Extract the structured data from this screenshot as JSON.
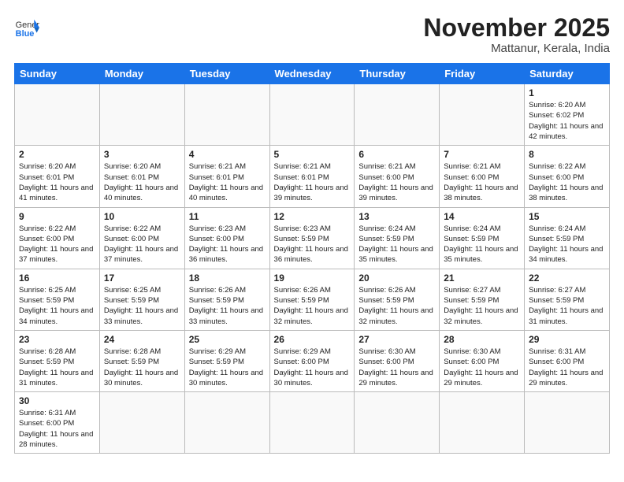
{
  "header": {
    "logo_general": "General",
    "logo_blue": "Blue",
    "month_title": "November 2025",
    "location": "Mattanur, Kerala, India"
  },
  "weekdays": [
    "Sunday",
    "Monday",
    "Tuesday",
    "Wednesday",
    "Thursday",
    "Friday",
    "Saturday"
  ],
  "weeks": [
    [
      {
        "day": "",
        "sunrise": "",
        "sunset": "",
        "daylight": ""
      },
      {
        "day": "",
        "sunrise": "",
        "sunset": "",
        "daylight": ""
      },
      {
        "day": "",
        "sunrise": "",
        "sunset": "",
        "daylight": ""
      },
      {
        "day": "",
        "sunrise": "",
        "sunset": "",
        "daylight": ""
      },
      {
        "day": "",
        "sunrise": "",
        "sunset": "",
        "daylight": ""
      },
      {
        "day": "",
        "sunrise": "",
        "sunset": "",
        "daylight": ""
      },
      {
        "day": "1",
        "sunrise": "Sunrise: 6:20 AM",
        "sunset": "Sunset: 6:02 PM",
        "daylight": "Daylight: 11 hours and 42 minutes."
      }
    ],
    [
      {
        "day": "2",
        "sunrise": "Sunrise: 6:20 AM",
        "sunset": "Sunset: 6:01 PM",
        "daylight": "Daylight: 11 hours and 41 minutes."
      },
      {
        "day": "3",
        "sunrise": "Sunrise: 6:20 AM",
        "sunset": "Sunset: 6:01 PM",
        "daylight": "Daylight: 11 hours and 40 minutes."
      },
      {
        "day": "4",
        "sunrise": "Sunrise: 6:21 AM",
        "sunset": "Sunset: 6:01 PM",
        "daylight": "Daylight: 11 hours and 40 minutes."
      },
      {
        "day": "5",
        "sunrise": "Sunrise: 6:21 AM",
        "sunset": "Sunset: 6:01 PM",
        "daylight": "Daylight: 11 hours and 39 minutes."
      },
      {
        "day": "6",
        "sunrise": "Sunrise: 6:21 AM",
        "sunset": "Sunset: 6:00 PM",
        "daylight": "Daylight: 11 hours and 39 minutes."
      },
      {
        "day": "7",
        "sunrise": "Sunrise: 6:21 AM",
        "sunset": "Sunset: 6:00 PM",
        "daylight": "Daylight: 11 hours and 38 minutes."
      },
      {
        "day": "8",
        "sunrise": "Sunrise: 6:22 AM",
        "sunset": "Sunset: 6:00 PM",
        "daylight": "Daylight: 11 hours and 38 minutes."
      }
    ],
    [
      {
        "day": "9",
        "sunrise": "Sunrise: 6:22 AM",
        "sunset": "Sunset: 6:00 PM",
        "daylight": "Daylight: 11 hours and 37 minutes."
      },
      {
        "day": "10",
        "sunrise": "Sunrise: 6:22 AM",
        "sunset": "Sunset: 6:00 PM",
        "daylight": "Daylight: 11 hours and 37 minutes."
      },
      {
        "day": "11",
        "sunrise": "Sunrise: 6:23 AM",
        "sunset": "Sunset: 6:00 PM",
        "daylight": "Daylight: 11 hours and 36 minutes."
      },
      {
        "day": "12",
        "sunrise": "Sunrise: 6:23 AM",
        "sunset": "Sunset: 5:59 PM",
        "daylight": "Daylight: 11 hours and 36 minutes."
      },
      {
        "day": "13",
        "sunrise": "Sunrise: 6:24 AM",
        "sunset": "Sunset: 5:59 PM",
        "daylight": "Daylight: 11 hours and 35 minutes."
      },
      {
        "day": "14",
        "sunrise": "Sunrise: 6:24 AM",
        "sunset": "Sunset: 5:59 PM",
        "daylight": "Daylight: 11 hours and 35 minutes."
      },
      {
        "day": "15",
        "sunrise": "Sunrise: 6:24 AM",
        "sunset": "Sunset: 5:59 PM",
        "daylight": "Daylight: 11 hours and 34 minutes."
      }
    ],
    [
      {
        "day": "16",
        "sunrise": "Sunrise: 6:25 AM",
        "sunset": "Sunset: 5:59 PM",
        "daylight": "Daylight: 11 hours and 34 minutes."
      },
      {
        "day": "17",
        "sunrise": "Sunrise: 6:25 AM",
        "sunset": "Sunset: 5:59 PM",
        "daylight": "Daylight: 11 hours and 33 minutes."
      },
      {
        "day": "18",
        "sunrise": "Sunrise: 6:26 AM",
        "sunset": "Sunset: 5:59 PM",
        "daylight": "Daylight: 11 hours and 33 minutes."
      },
      {
        "day": "19",
        "sunrise": "Sunrise: 6:26 AM",
        "sunset": "Sunset: 5:59 PM",
        "daylight": "Daylight: 11 hours and 32 minutes."
      },
      {
        "day": "20",
        "sunrise": "Sunrise: 6:26 AM",
        "sunset": "Sunset: 5:59 PM",
        "daylight": "Daylight: 11 hours and 32 minutes."
      },
      {
        "day": "21",
        "sunrise": "Sunrise: 6:27 AM",
        "sunset": "Sunset: 5:59 PM",
        "daylight": "Daylight: 11 hours and 32 minutes."
      },
      {
        "day": "22",
        "sunrise": "Sunrise: 6:27 AM",
        "sunset": "Sunset: 5:59 PM",
        "daylight": "Daylight: 11 hours and 31 minutes."
      }
    ],
    [
      {
        "day": "23",
        "sunrise": "Sunrise: 6:28 AM",
        "sunset": "Sunset: 5:59 PM",
        "daylight": "Daylight: 11 hours and 31 minutes."
      },
      {
        "day": "24",
        "sunrise": "Sunrise: 6:28 AM",
        "sunset": "Sunset: 5:59 PM",
        "daylight": "Daylight: 11 hours and 30 minutes."
      },
      {
        "day": "25",
        "sunrise": "Sunrise: 6:29 AM",
        "sunset": "Sunset: 5:59 PM",
        "daylight": "Daylight: 11 hours and 30 minutes."
      },
      {
        "day": "26",
        "sunrise": "Sunrise: 6:29 AM",
        "sunset": "Sunset: 6:00 PM",
        "daylight": "Daylight: 11 hours and 30 minutes."
      },
      {
        "day": "27",
        "sunrise": "Sunrise: 6:30 AM",
        "sunset": "Sunset: 6:00 PM",
        "daylight": "Daylight: 11 hours and 29 minutes."
      },
      {
        "day": "28",
        "sunrise": "Sunrise: 6:30 AM",
        "sunset": "Sunset: 6:00 PM",
        "daylight": "Daylight: 11 hours and 29 minutes."
      },
      {
        "day": "29",
        "sunrise": "Sunrise: 6:31 AM",
        "sunset": "Sunset: 6:00 PM",
        "daylight": "Daylight: 11 hours and 29 minutes."
      }
    ],
    [
      {
        "day": "30",
        "sunrise": "Sunrise: 6:31 AM",
        "sunset": "Sunset: 6:00 PM",
        "daylight": "Daylight: 11 hours and 28 minutes."
      },
      {
        "day": "",
        "sunrise": "",
        "sunset": "",
        "daylight": ""
      },
      {
        "day": "",
        "sunrise": "",
        "sunset": "",
        "daylight": ""
      },
      {
        "day": "",
        "sunrise": "",
        "sunset": "",
        "daylight": ""
      },
      {
        "day": "",
        "sunrise": "",
        "sunset": "",
        "daylight": ""
      },
      {
        "day": "",
        "sunrise": "",
        "sunset": "",
        "daylight": ""
      },
      {
        "day": "",
        "sunrise": "",
        "sunset": "",
        "daylight": ""
      }
    ]
  ]
}
